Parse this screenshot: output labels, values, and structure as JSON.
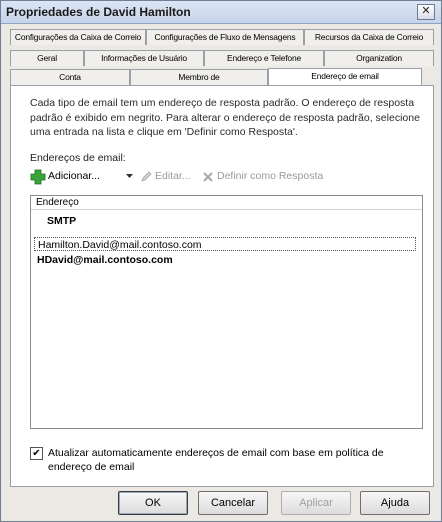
{
  "window": {
    "title": "Propriedades de David Hamilton",
    "close_glyph": "✕"
  },
  "tabs": {
    "row1": [
      "Configurações da Caixa de Correio",
      "Configurações de Fluxo de Mensagens",
      "Recursos da Caixa de Correio"
    ],
    "row2": [
      "Geral",
      "Informações de Usuário",
      "Endereço e Telefone",
      "Organization"
    ],
    "row3": [
      "Conta",
      "Membro de",
      "Endereço de email"
    ],
    "active": "Endereço de email"
  },
  "panel": {
    "description": "Cada tipo de email tem um endereço de resposta padrão. O endereço de resposta padrão é exibido em negrito.  Para alterar o endereço de resposta padrão, selecione uma entrada na lista e clique em 'Definir como Resposta'.",
    "list_label": "Endereços de email:",
    "toolbar": {
      "add": "Adicionar...",
      "edit": "Editar...",
      "set_reply": "Definir como Resposta"
    },
    "list": {
      "header": "Endereço",
      "group": "SMTP",
      "rows": [
        {
          "address": "Hamilton.David@mail.contoso.com"
        },
        {
          "address": "HDavid@mail.contoso.com"
        }
      ]
    },
    "auto_update": {
      "checked": true,
      "check_glyph": "✔",
      "label": "Atualizar automaticamente endereços de email com base em política de endereço de email"
    }
  },
  "buttons": {
    "ok": "OK",
    "cancel": "Cancelar",
    "apply": "Aplicar",
    "help": "Ajuda"
  },
  "colors": {
    "title_bg": "#c6d4ea",
    "add_icon": "#3aa33a",
    "disabled_text": "#9a9a9a"
  }
}
